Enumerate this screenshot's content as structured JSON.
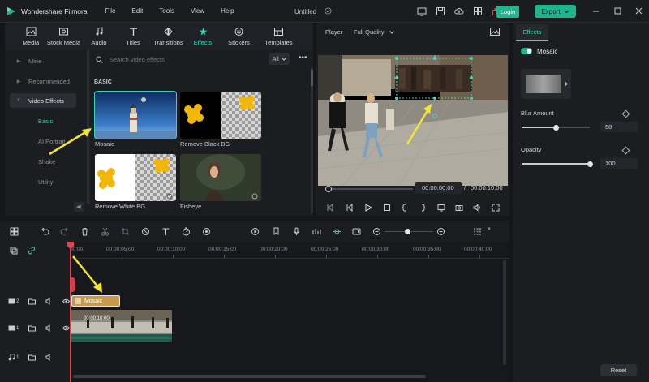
{
  "app": {
    "title": "Wondershare Filmora",
    "doc_title": "Untitled"
  },
  "menu": [
    "File",
    "Edit",
    "Tools",
    "View",
    "Help"
  ],
  "header": {
    "login_label": "Login",
    "export_label": "Export"
  },
  "colors": {
    "accent": "#1fb58f",
    "accent_text": "#35d4b4",
    "playhead": "#e0454e",
    "mosaic_clip": "#c59a4d",
    "annotation_arrow": "#f2e633"
  },
  "library": {
    "tabs": [
      {
        "label": "Media",
        "icon": "media-icon"
      },
      {
        "label": "Stock Media",
        "icon": "stock-media-icon"
      },
      {
        "label": "Audio",
        "icon": "audio-icon"
      },
      {
        "label": "Titles",
        "icon": "titles-icon"
      },
      {
        "label": "Transitions",
        "icon": "transitions-icon"
      },
      {
        "label": "Effects",
        "icon": "effects-icon",
        "active": true
      },
      {
        "label": "Stickers",
        "icon": "stickers-icon"
      },
      {
        "label": "Templates",
        "icon": "templates-icon"
      }
    ],
    "sidebar": {
      "items": [
        "Mine",
        "Recommended",
        "Video Effects"
      ],
      "subitems": [
        "Basic",
        "AI Portrait",
        "Shake",
        "Utility"
      ],
      "active_subitem": "Basic"
    },
    "search_placeholder": "Search video effects",
    "filter_label": "All",
    "section_label": "BASIC",
    "cards": [
      {
        "label": "Mosaic",
        "selected": true
      },
      {
        "label": "Remove Black BG"
      },
      {
        "label": "Remove White BG"
      },
      {
        "label": "Fisheye"
      }
    ]
  },
  "player": {
    "label": "Player",
    "quality": "Full Quality",
    "current_time": "00:00:00:00",
    "separator": "/",
    "total_time": "00:00:10:00"
  },
  "properties": {
    "tab": "Effects",
    "effect_name": "Mosaic",
    "blur_amount": {
      "label": "Blur Amount",
      "value": "50",
      "fraction": 0.5
    },
    "opacity": {
      "label": "Opacity",
      "value": "100",
      "fraction": 1.0
    },
    "reset_label": "Reset"
  },
  "timeline": {
    "ruler": [
      "00:00",
      "00:00:05:00",
      "00:00:10:00",
      "00:00:15:00",
      "00:00:20:00",
      "00:00:25:00",
      "00:00:30:00",
      "00:00:35:00",
      "00:00:40:00"
    ],
    "tracks": [
      {
        "index": "2",
        "kind": "effect"
      },
      {
        "index": "1",
        "kind": "video"
      },
      {
        "index": "1",
        "kind": "audio"
      }
    ],
    "effect_clip_label": "Mosaic",
    "video_clip_label": "00:00:10:00"
  }
}
